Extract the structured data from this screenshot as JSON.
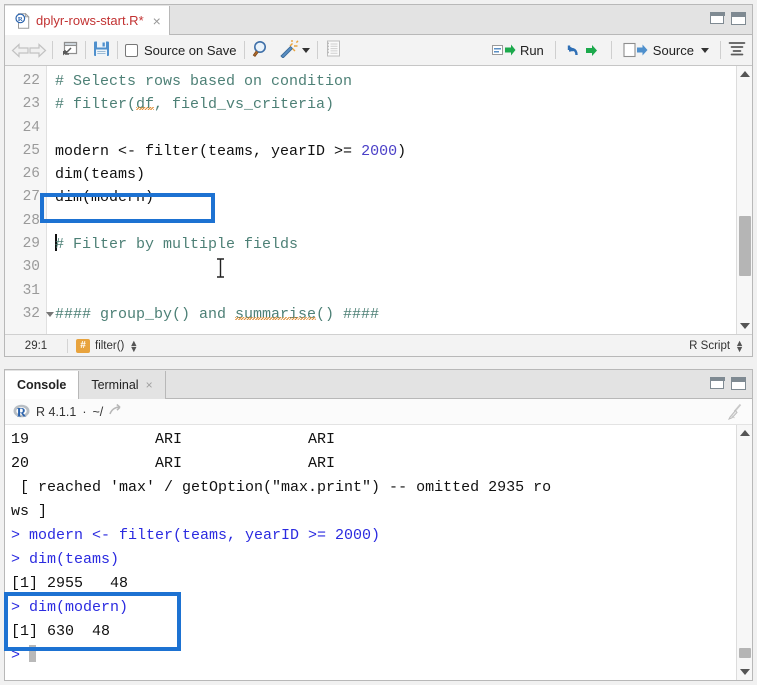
{
  "source_pane": {
    "tab": {
      "title": "dplyr-rows-start.R*",
      "icon": "r-document-icon",
      "close": "×"
    },
    "window_controls": {
      "minimize": "minimize-icon",
      "maximize": "maximize-icon"
    },
    "toolbar": {
      "back": "back-arrow-icon",
      "forward": "forward-arrow-icon",
      "show_in_new_window": "popout-icon",
      "save": "save-icon",
      "source_on_save_label": "Source on Save",
      "find": "search-icon",
      "code_tools": "magic-wand-icon",
      "compile_report": "notebook-icon",
      "run_label": "Run",
      "rerun": "rerun-icon",
      "source_label": "Source",
      "outline": "outline-icon"
    },
    "editor": {
      "lines": [
        {
          "no": "22",
          "fold": false,
          "segments": [
            {
              "t": "# Selects rows based on condition",
              "c": "cmt"
            }
          ]
        },
        {
          "no": "23",
          "fold": false,
          "segments": [
            {
              "t": "# filter(",
              "c": "cmt"
            },
            {
              "t": "df",
              "c": "cmt squig"
            },
            {
              "t": ", field_vs_criteria)",
              "c": "cmt"
            }
          ]
        },
        {
          "no": "24",
          "fold": false,
          "segments": []
        },
        {
          "no": "25",
          "fold": false,
          "segments": [
            {
              "t": "modern <- filter(teams, yearID >= ",
              "c": ""
            },
            {
              "t": "2000",
              "c": "num"
            },
            {
              "t": ")",
              "c": ""
            }
          ]
        },
        {
          "no": "26",
          "fold": false,
          "segments": [
            {
              "t": "dim(teams)",
              "c": ""
            }
          ]
        },
        {
          "no": "27",
          "fold": false,
          "segments": [
            {
              "t": "dim(modern)",
              "c": ""
            }
          ]
        },
        {
          "no": "28",
          "fold": false,
          "segments": []
        },
        {
          "no": "29",
          "fold": false,
          "cursor": true,
          "segments": [
            {
              "t": "# Filter by multiple fields",
              "c": "cmt"
            }
          ]
        },
        {
          "no": "30",
          "fold": false,
          "segments": []
        },
        {
          "no": "31",
          "fold": false,
          "segments": []
        },
        {
          "no": "32",
          "fold": true,
          "segments": [
            {
              "t": "#### group_by() and ",
              "c": "cmt"
            },
            {
              "t": "summarise",
              "c": "cmt squig"
            },
            {
              "t": "() ####",
              "c": "cmt"
            }
          ]
        }
      ]
    },
    "status": {
      "cursor_position": "29:1",
      "scope_badge": "#",
      "scope_label": "filter()",
      "file_type": "R Script"
    }
  },
  "console_pane": {
    "tabs": [
      {
        "label": "Console",
        "active": true,
        "closable": false
      },
      {
        "label": "Terminal",
        "active": false,
        "closable": true,
        "close": "×"
      }
    ],
    "window_controls": {
      "minimize": "minimize-icon",
      "maximize": "maximize-icon"
    },
    "session": {
      "logo": "r-logo-icon",
      "version": "R 4.1.1",
      "separator": "·",
      "working_dir": "~/",
      "open_dir_icon": "open-in-new-icon",
      "clear_icon": "broom-icon"
    },
    "output": [
      {
        "text": "19              ARI              ARI",
        "kind": "out"
      },
      {
        "text": "20              ARI              ARI",
        "kind": "out"
      },
      {
        "text": " [ reached 'max' / getOption(\"max.print\") -- omitted 2935 ro",
        "kind": "out"
      },
      {
        "text": "ws ]",
        "kind": "out"
      },
      {
        "text": "> modern <- filter(teams, yearID >= 2000)",
        "kind": "cmd"
      },
      {
        "text": "> dim(teams)",
        "kind": "cmd"
      },
      {
        "text": "[1] 2955   48",
        "kind": "out"
      },
      {
        "text": "> dim(modern)",
        "kind": "cmd"
      },
      {
        "text": "[1] 630  48",
        "kind": "out"
      },
      {
        "text": "> ",
        "kind": "prompt"
      }
    ]
  },
  "annotations": {
    "highlight_color": "#1d72d2",
    "editor_highlight_target": "dim(modern)",
    "console_highlight_target": "> dim(modern) / [1] 630  48"
  }
}
